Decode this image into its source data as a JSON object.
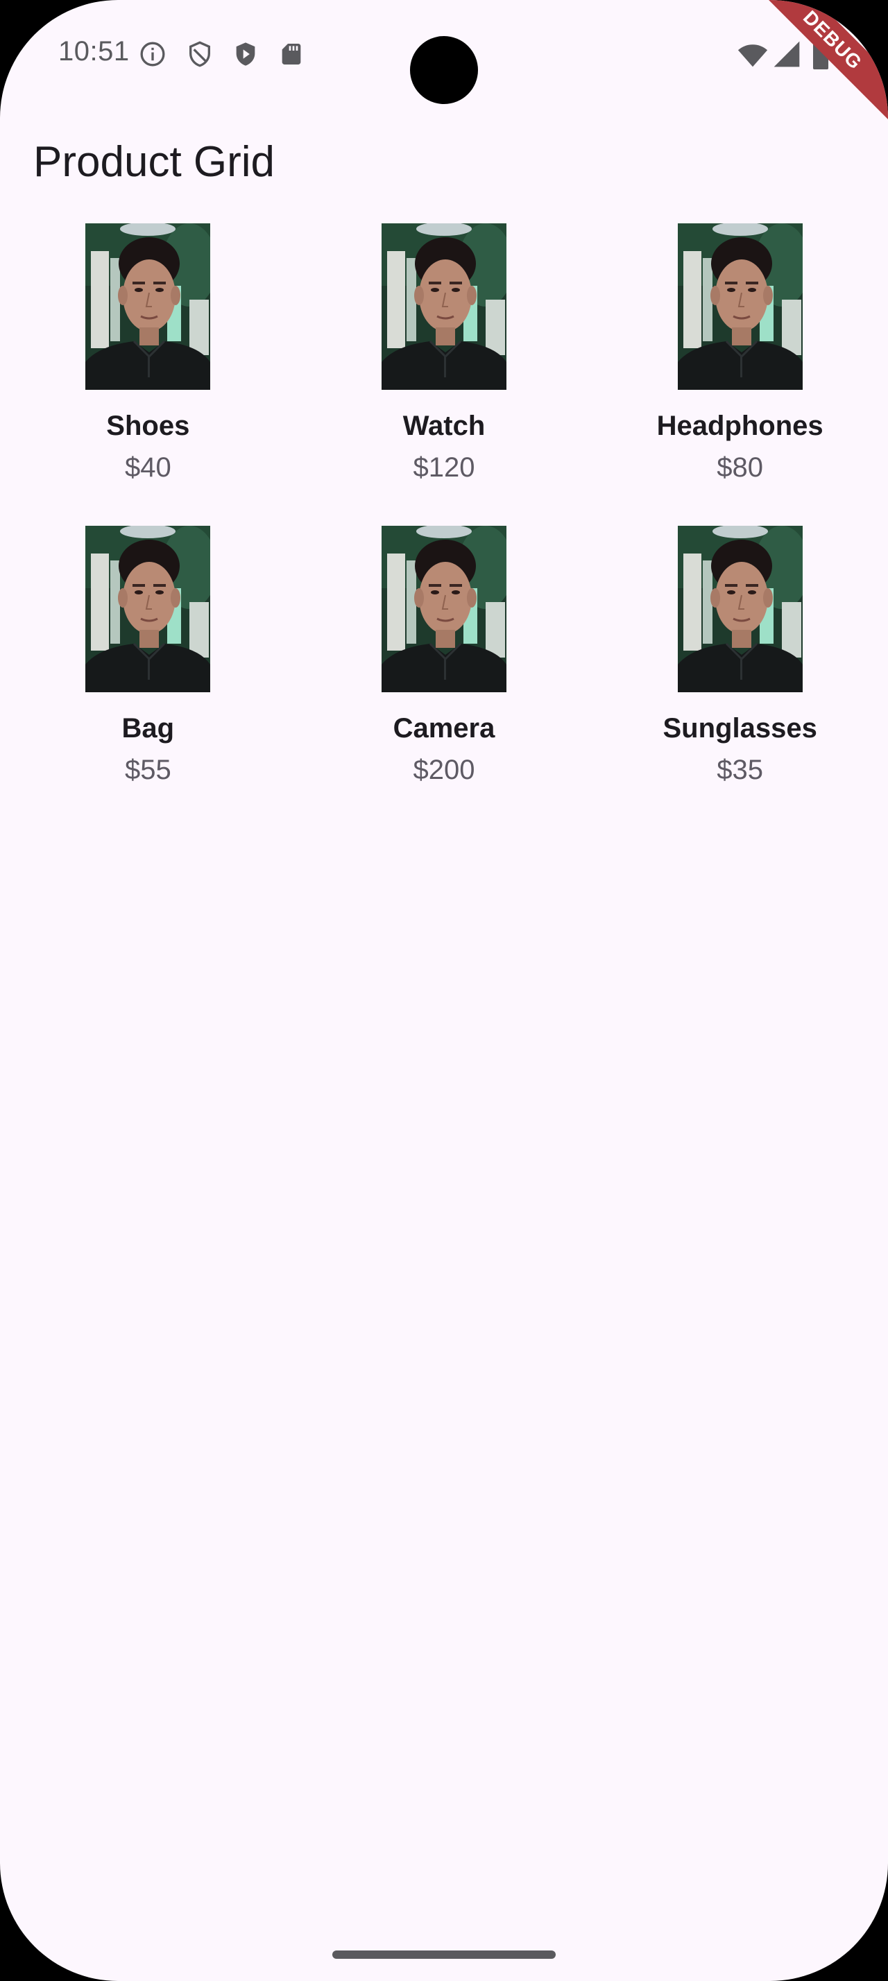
{
  "status_bar": {
    "time": "10:51",
    "icons_left": [
      "info-icon",
      "shield-outline-icon",
      "play-shield-icon",
      "sd-card-icon"
    ],
    "icons_right": [
      "wifi-icon",
      "signal-icon",
      "battery-icon"
    ]
  },
  "debug_banner": "DEBUG",
  "app_bar": {
    "title": "Product Grid"
  },
  "products": [
    {
      "name": "Shoes",
      "price": "$40"
    },
    {
      "name": "Watch",
      "price": "$120"
    },
    {
      "name": "Headphones",
      "price": "$80"
    },
    {
      "name": "Bag",
      "price": "$55"
    },
    {
      "name": "Camera",
      "price": "$200"
    },
    {
      "name": "Sunglasses",
      "price": "$35"
    }
  ],
  "colors": {
    "background": "#fdf7fe",
    "title_text": "#1d1b20",
    "price_text": "#5e5a64",
    "debug_banner": "#b13a3e"
  }
}
